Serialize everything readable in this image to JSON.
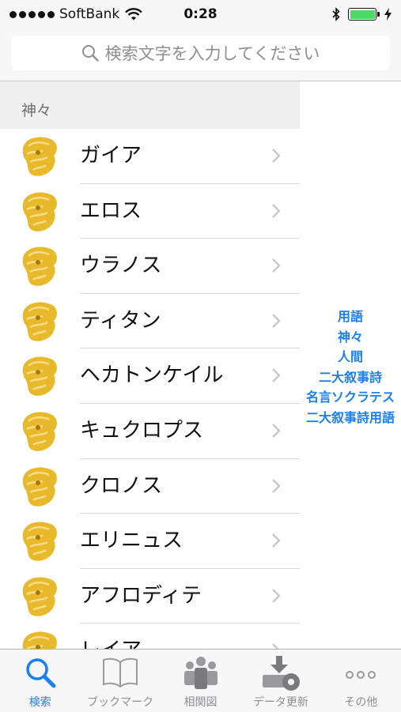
{
  "status_bar": {
    "carrier": "SoftBank",
    "time": "0:28"
  },
  "search": {
    "placeholder": "検索文字を入力してください"
  },
  "section": {
    "title": "神々"
  },
  "list": {
    "items": [
      "ガイア",
      "エロス",
      "ウラノス",
      "ティタン",
      "ヘカトンケイル",
      "キュクロプス",
      "クロノス",
      "エリニュス",
      "アフロディテ",
      "レイア"
    ]
  },
  "index": {
    "items": [
      "用語",
      "神々",
      "人間",
      "二大叙事詩",
      "名言ソクラテス",
      "二大叙事詩用語"
    ]
  },
  "tabbar": {
    "tabs": [
      {
        "label": "検索",
        "icon": "search-icon",
        "active": true
      },
      {
        "label": "ブックマーク",
        "icon": "book-icon",
        "active": false
      },
      {
        "label": "相関図",
        "icon": "people-icon",
        "active": false
      },
      {
        "label": "データ更新",
        "icon": "download-gear-icon",
        "active": false
      },
      {
        "label": "その他",
        "icon": "more-icon",
        "active": false
      }
    ]
  },
  "colors": {
    "accent": "#1a7ff0",
    "battery": "#4cd964",
    "thumb": "#e8b92a"
  }
}
